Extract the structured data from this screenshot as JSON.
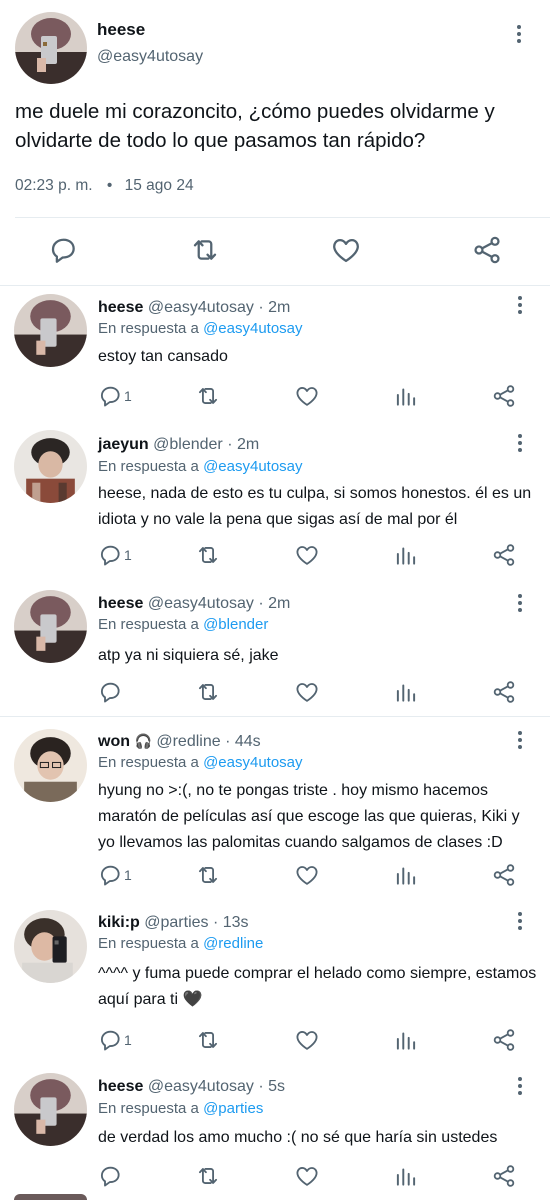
{
  "main": {
    "name": "heese",
    "handle": "@easy4utosay",
    "text": "me duele mi corazoncito, ¿cómo puedes olvidarme y olvidarte de todo lo que pasamos tan rápido?",
    "time": "02:23 p. m.",
    "dot": "•",
    "date": "15 ago 24",
    "actions": [
      "reply-icon",
      "retweet-icon",
      "like-icon",
      "share-icon"
    ]
  },
  "replies": [
    {
      "name": "heese",
      "handle": "@easy4utosay",
      "time": "· 2m",
      "resp_prefix": "En respuesta a",
      "resp_to": "@easy4utosay",
      "text": "estoy tan cansado",
      "reply_count": "1"
    },
    {
      "name": "jaeyun",
      "handle": "@blender",
      "time": "· 2m",
      "resp_prefix": "En respuesta a",
      "resp_to": "@easy4utosay",
      "text": "heese, nada de esto es tu culpa, si somos honestos. él es un idiota y no vale la pena que sigas así de mal por él",
      "reply_count": "1"
    },
    {
      "name": "heese",
      "handle": "@easy4utosay",
      "time": "· 2m",
      "resp_prefix": "En respuesta a",
      "resp_to": "@blender",
      "text": "atp ya ni siquiera sé, jake",
      "reply_count": ""
    },
    {
      "name": "won",
      "name_icon": "🎧",
      "handle": "@redline",
      "time": "· 44s",
      "resp_prefix": "En respuesta a",
      "resp_to": "@easy4utosay",
      "text": "hyung no >:(, no te pongas triste . hoy mismo hacemos maratón de películas así que escoge las que quieras, Kiki y yo llevamos las palomitas cuando salgamos de clases :D",
      "reply_count": "1"
    },
    {
      "name": "kiki:p",
      "handle": "@parties",
      "time": "· 13s",
      "resp_prefix": "En respuesta a",
      "resp_to": "@redline",
      "text": "^^^^ y fuma puede comprar el helado como siempre, estamos aquí para ti 🖤",
      "reply_count": "1"
    },
    {
      "name": "heese",
      "handle": "@easy4utosay",
      "time": "· 5s",
      "resp_prefix": "En respuesta a",
      "resp_to": "@parties",
      "text": "de verdad los amo mucho :( no sé que haría sin ustedes",
      "reply_count": ""
    }
  ],
  "icons": {
    "reply": "reply-icon",
    "retweet": "retweet-icon",
    "like": "like-icon",
    "stats": "stats-icon",
    "share": "share-icon",
    "more": "more-icon"
  },
  "colors": {
    "accent": "#1d9bf0",
    "muted": "#536471",
    "text": "#0f1419",
    "divider": "#e6ecf0"
  }
}
